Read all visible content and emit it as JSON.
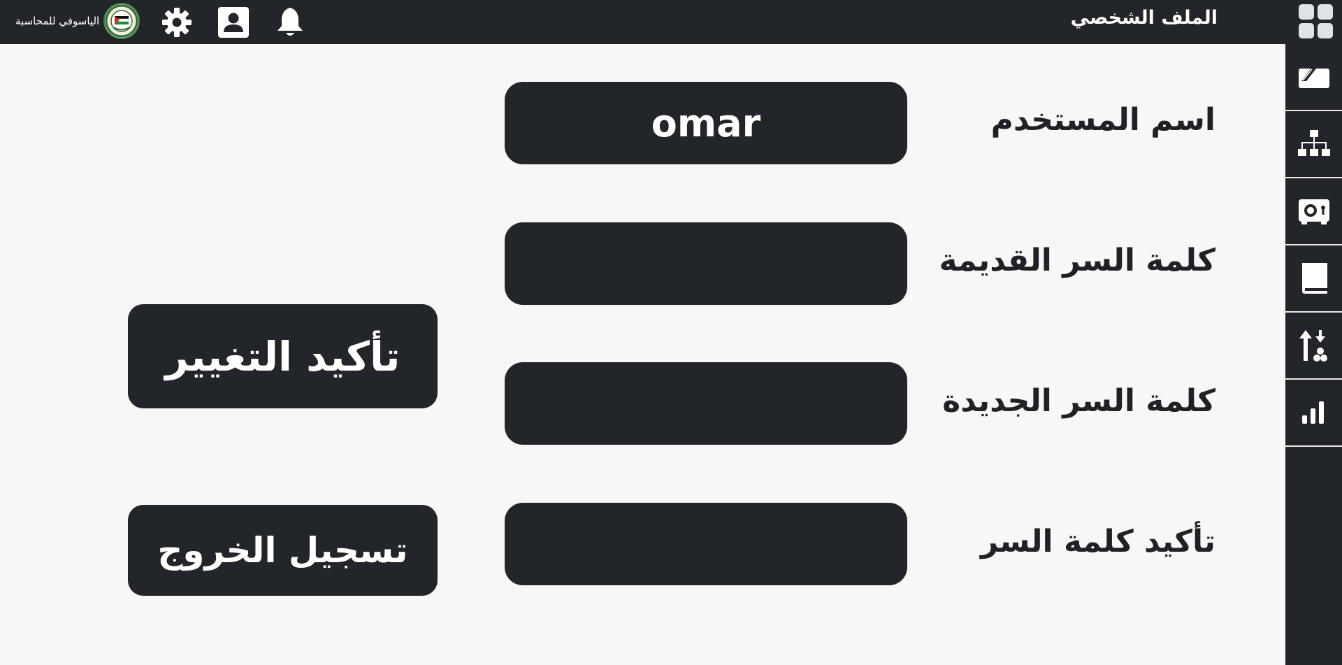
{
  "header": {
    "logo_text": "الياسوفي للمحاسبة",
    "title": "الملف الشخصي",
    "icons": [
      "settings-gear-icon",
      "user-profile-icon",
      "notification-bell-icon",
      "apps-grid-icon"
    ]
  },
  "sidebar": {
    "items": [
      {
        "icon": "wallet-card-icon"
      },
      {
        "icon": "org-chart-icon"
      },
      {
        "icon": "safe-vault-icon"
      },
      {
        "icon": "book-icon"
      },
      {
        "icon": "sort-arrows-icon"
      },
      {
        "icon": "bar-chart-icon"
      }
    ]
  },
  "form": {
    "username_label": "اسم المستخدم",
    "username_value": "omar",
    "old_password_label": "كلمة السر القديمة",
    "old_password_value": "",
    "new_password_label": "كلمة السر الجديدة",
    "new_password_value": "",
    "confirm_password_label": "تأكيد كلمة السر",
    "confirm_password_value": ""
  },
  "actions": {
    "confirm_change_label": "تأكيد التغيير",
    "logout_label": "تسجيل الخروج"
  },
  "colors": {
    "dark": "#22252a",
    "background": "#f7f7f7",
    "text_dark": "#1e2125",
    "text_light": "#ffffff"
  }
}
